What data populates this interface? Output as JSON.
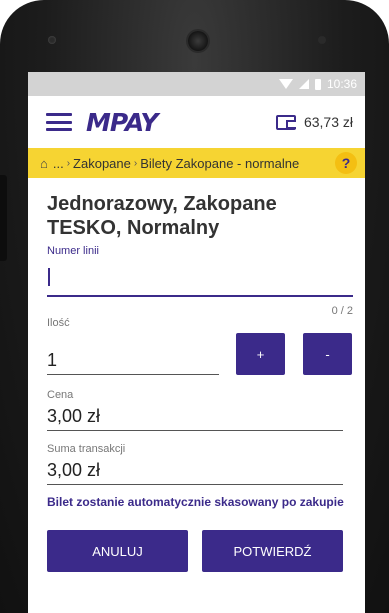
{
  "status_bar": {
    "time": "10:36"
  },
  "app": {
    "logo": "MPAY",
    "balance": "63,73 zł"
  },
  "breadcrumb": {
    "ellipsis": "...",
    "items": [
      "Zakopane",
      "Bilety Zakopane - normalne"
    ],
    "help": "?"
  },
  "ticket": {
    "title": "Jednorazowy, Zakopane TESKO, Normalny"
  },
  "line_number": {
    "label": "Numer linii",
    "value": "",
    "counter": "0 / 2"
  },
  "quantity": {
    "label": "Ilość",
    "value": "1",
    "plus_label": "+",
    "minus_label": "-"
  },
  "price": {
    "label": "Cena",
    "value": "3,00 zł"
  },
  "total": {
    "label": "Suma transakcji",
    "value": "3,00 zł"
  },
  "note": "Bilet zostanie automatycznie skasowany po zakupie",
  "actions": {
    "cancel_label": "ANULUJ",
    "confirm_label": "POTWIERDŹ"
  },
  "colors": {
    "primary": "#3b2a8a",
    "breadcrumb_bg": "#f6d432",
    "help_bg": "#f4bf12"
  }
}
